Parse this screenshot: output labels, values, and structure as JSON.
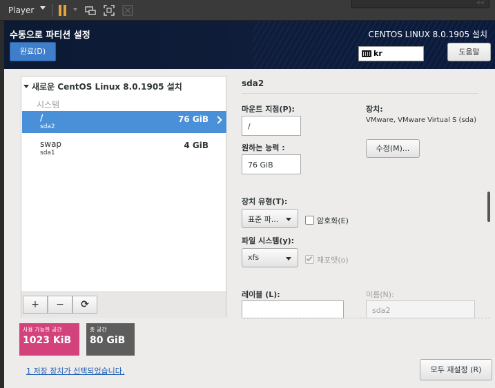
{
  "vm_toolbar": {
    "player_label": "Player"
  },
  "header": {
    "page_title": "수동으로 파티션 설정",
    "done_button": "완료(D)",
    "product_title": "CENTOS LINUX 8.0.1905 설치",
    "keyboard_layout": "kr",
    "help_button": "도움말"
  },
  "left_panel": {
    "install_heading": "새로운 CentOS Linux 8.0.1905 설치",
    "group_label": "시스템",
    "mount_points": [
      {
        "name": "/",
        "device": "sda2",
        "size": "76 GiB",
        "selected": true
      },
      {
        "name": "swap",
        "device": "sda1",
        "size": "4 GiB",
        "selected": false
      }
    ],
    "add_button": "+",
    "remove_button": "−",
    "refresh_button": "⟳"
  },
  "space": {
    "available_label": "사용 가능한 공간",
    "available_value": "1023 KiB",
    "available_color": "#d3427b",
    "total_label": "총 공간",
    "total_value": "80 GiB",
    "total_color": "#5d5d5d"
  },
  "storage_link": "1  저장 장치가 선택되었습니다.",
  "reset_button": "모두 재설정 (R)",
  "detail": {
    "title": "sda2",
    "mount_point_label": "마운트 지점(P):",
    "mount_point_value": "/",
    "capacity_label": "원하는 능력 :",
    "capacity_value": "76 GiB",
    "device_label": "장치:",
    "device_desc": "VMware, VMware Virtual S (sda)",
    "modify_button": "수정(M)...",
    "device_type_label": "장치 유형(T):",
    "device_type_value": "표준 파...",
    "encrypt_label": "암호화(E)",
    "filesystem_label": "파일 시스템(y):",
    "filesystem_value": "xfs",
    "reformat_label": "재포맷(o)",
    "label_label": "레이블 (L):",
    "label_value": "",
    "name_label": "이름(N):",
    "name_value": "sda2"
  }
}
